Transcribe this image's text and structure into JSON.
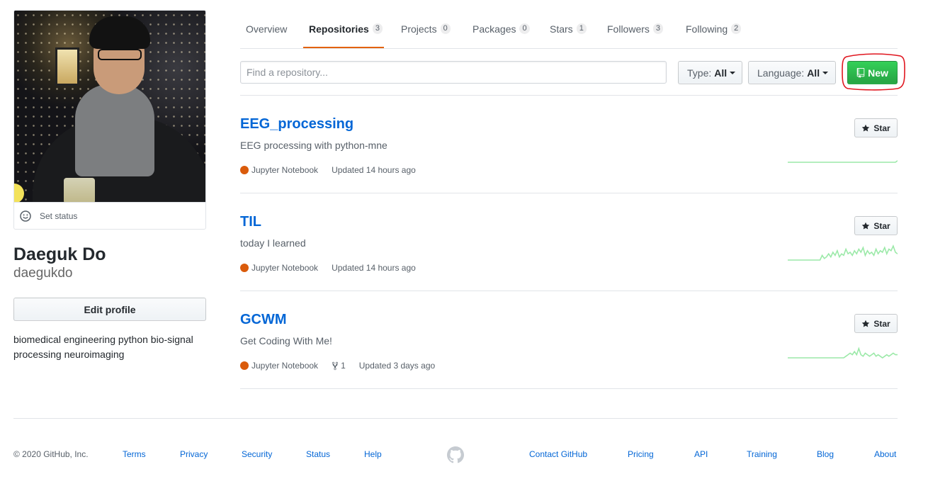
{
  "profile": {
    "set_status": "Set status",
    "name": "Daeguk Do",
    "login": "daegukdo",
    "edit_profile": "Edit profile",
    "bio": "biomedical engineering python bio-signal processing neuroimaging"
  },
  "tabs": [
    {
      "label": "Overview",
      "count": null
    },
    {
      "label": "Repositories",
      "count": "3"
    },
    {
      "label": "Projects",
      "count": "0"
    },
    {
      "label": "Packages",
      "count": "0"
    },
    {
      "label": "Stars",
      "count": "1"
    },
    {
      "label": "Followers",
      "count": "3"
    },
    {
      "label": "Following",
      "count": "2"
    }
  ],
  "search": {
    "placeholder": "Find a repository..."
  },
  "filters": {
    "type_label": "Type:",
    "type_value": "All",
    "language_label": "Language:",
    "language_value": "All",
    "new_label": "New"
  },
  "repos": [
    {
      "name": "EEG_processing",
      "description": "EEG processing with python-mne",
      "language": "Jupyter Notebook",
      "forks": null,
      "updated": "Updated 14 hours ago",
      "star_label": "Star",
      "activity": [
        0,
        0,
        0,
        0,
        0,
        0,
        0,
        0,
        0,
        0,
        0,
        0,
        0,
        0,
        0,
        0,
        0,
        0,
        0,
        0,
        0,
        0,
        0,
        0,
        0,
        0,
        0,
        0,
        0,
        0,
        0,
        0,
        0,
        0,
        0,
        0,
        0,
        0,
        0,
        0,
        0,
        0,
        0,
        0,
        0,
        0,
        0,
        0,
        0,
        0,
        0,
        1
      ]
    },
    {
      "name": "TIL",
      "description": "today I learned",
      "language": "Jupyter Notebook",
      "forks": null,
      "updated": "Updated 14 hours ago",
      "star_label": "Star",
      "activity": [
        0,
        0,
        0,
        0,
        0,
        0,
        0,
        0,
        0,
        0,
        0,
        0,
        0,
        0,
        0,
        0,
        3,
        1,
        2,
        4,
        2,
        5,
        3,
        6,
        2,
        4,
        3,
        7,
        4,
        5,
        3,
        6,
        4,
        7,
        5,
        8,
        3,
        6,
        4,
        5,
        3,
        7,
        4,
        6,
        5,
        8,
        4,
        7,
        6,
        9,
        5,
        4
      ]
    },
    {
      "name": "GCWM",
      "description": "Get Coding With Me!",
      "language": "Jupyter Notebook",
      "forks": "1",
      "updated": "Updated 3 days ago",
      "star_label": "Star",
      "activity": [
        0,
        0,
        0,
        0,
        0,
        0,
        0,
        0,
        0,
        0,
        0,
        0,
        0,
        0,
        0,
        0,
        0,
        0,
        0,
        0,
        0,
        0,
        0,
        0,
        0,
        0,
        0,
        1,
        2,
        3,
        2,
        4,
        2,
        6,
        2,
        1,
        3,
        2,
        1,
        2,
        3,
        1,
        2,
        1,
        0,
        1,
        2,
        1,
        2,
        3,
        2,
        2
      ]
    }
  ],
  "footer": {
    "copyright": "© 2020 GitHub, Inc.",
    "links": [
      "Terms",
      "Privacy",
      "Security",
      "Status",
      "Help",
      "Contact GitHub",
      "Pricing",
      "API",
      "Training",
      "Blog",
      "About"
    ]
  },
  "colors": {
    "accent": "#0366d6",
    "tab_underline": "#e36209",
    "new_button": "#28a745",
    "jupyter": "#DA5B0B",
    "spark": "#9be9a8",
    "highlight": "#e0161f"
  },
  "icons": [
    "smiley-icon",
    "repo-icon",
    "star-icon",
    "repo-forked-icon",
    "mark-github-icon"
  ]
}
